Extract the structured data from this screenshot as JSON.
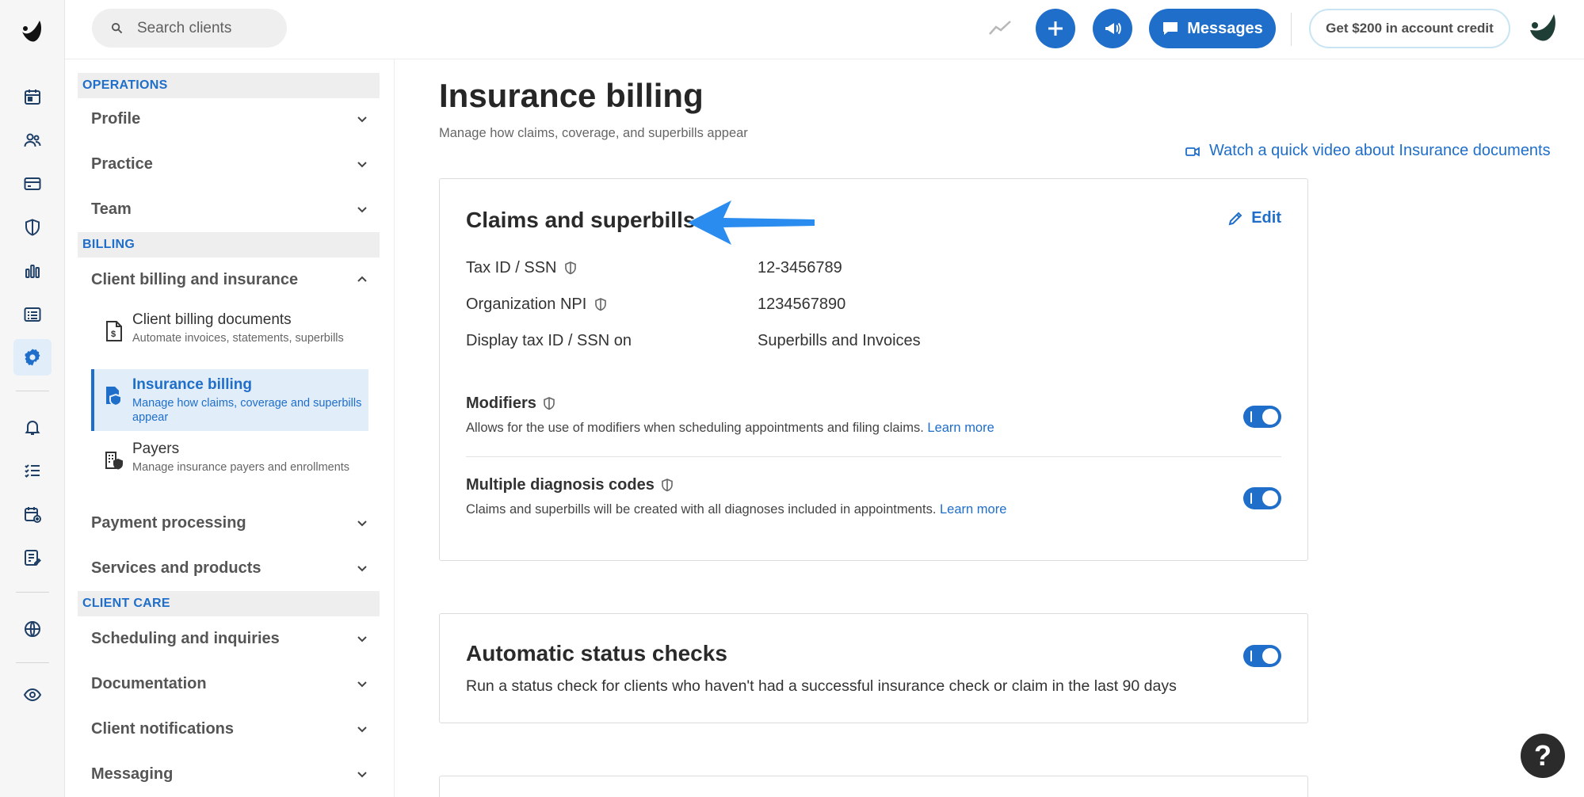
{
  "colors": {
    "accent": "#1f6ec9",
    "accent_bg": "#e1edf9",
    "section_bg": "#eeeeee",
    "toggle_on": "#1f6ec9"
  },
  "rail": {
    "icons": [
      "logo-icon",
      "calendar-icon",
      "clients-icon",
      "billing-card-icon",
      "shield-icon",
      "analytics-icon",
      "list-icon",
      "settings-gear-icon",
      "bell-icon",
      "tasks-icon",
      "calendar-add-icon",
      "notes-icon",
      "globe-icon",
      "eye-icon"
    ],
    "active": "settings-gear-icon"
  },
  "topbar": {
    "search_placeholder": "Search clients",
    "messages_label": "Messages",
    "credit_label": "Get $200 in account credit"
  },
  "sidebar": {
    "operations_header": "OPERATIONS",
    "profile": "Profile",
    "practice": "Practice",
    "team": "Team",
    "billing_header": "BILLING",
    "client_billing_insurance": "Client billing and insurance",
    "sub_items": [
      {
        "title": "Client billing documents",
        "desc": "Automate invoices, statements, superbills"
      },
      {
        "title": "Insurance billing",
        "desc": "Manage how claims, coverage and superbills appear"
      },
      {
        "title": "Payers",
        "desc": "Manage insurance payers and enrollments"
      }
    ],
    "payment_processing": "Payment processing",
    "services_products": "Services and products",
    "client_care_header": "CLIENT CARE",
    "scheduling_inquiries": "Scheduling and inquiries",
    "documentation": "Documentation",
    "client_notifications": "Client notifications",
    "messaging": "Messaging"
  },
  "main": {
    "title": "Insurance billing",
    "subtitle": "Manage how claims, coverage, and superbills appear",
    "video_link": "Watch a quick video about Insurance documents",
    "claims": {
      "title": "Claims and superbills",
      "edit_label": "Edit",
      "rows": [
        {
          "label": "Tax ID / SSN",
          "value": "12-3456789"
        },
        {
          "label": "Organization NPI",
          "value": "1234567890"
        },
        {
          "label": "Display tax ID / SSN on",
          "value": "Superbills and Invoices"
        }
      ],
      "modifiers": {
        "title": "Modifiers",
        "desc": "Allows for the use of modifiers when scheduling appointments and filing claims.",
        "learn": "Learn more",
        "enabled": true
      },
      "diagnosis": {
        "title": "Multiple diagnosis codes",
        "desc": "Claims and superbills will be created with all diagnoses included in appointments.",
        "learn": "Learn more",
        "enabled": true
      }
    },
    "status_checks": {
      "title": "Automatic status checks",
      "desc": "Run a status check for clients who haven't had a successful insurance check or claim in the last 90 days",
      "enabled": true
    }
  },
  "help_label": "?"
}
